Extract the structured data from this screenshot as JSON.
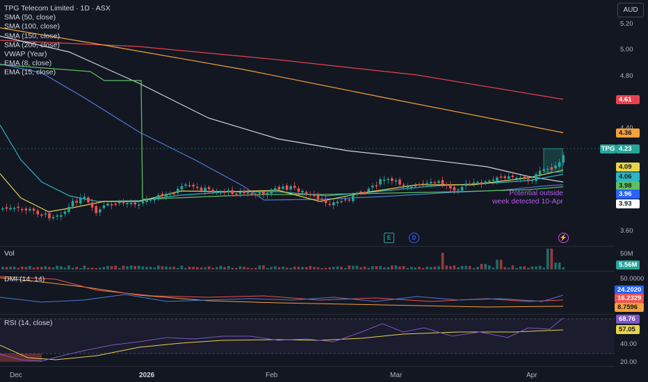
{
  "header": {
    "title": "TPG Telecom Limited · 1D · ASX",
    "currency": "AUD"
  },
  "legend": [
    {
      "label": "SMA (50, close)"
    },
    {
      "label": "SMA (100, close)"
    },
    {
      "label": "SMA (150, close)"
    },
    {
      "label": "SMA (200, close)"
    },
    {
      "label": "VWAP (Year)"
    },
    {
      "label": "EMA (8, close)"
    },
    {
      "label": "EMA (15, close)"
    }
  ],
  "price_axis": [
    "5.20",
    "5.00",
    "4.80",
    "4.40",
    "3.60"
  ],
  "tags": {
    "ticker": "TPG",
    "last": "4.23",
    "sma200": "4.61",
    "sma150": "4.36",
    "ema8": "4.09",
    "ema15": "4.06",
    "sma50": "3.98",
    "vwap": "3.96",
    "other": "3.93"
  },
  "note": "Potential outside week detected 10-Apr",
  "events": {
    "earnings": "E",
    "dividend": "D"
  },
  "volume": {
    "label": "Vol",
    "axis_top": "50M",
    "last": "5.56M"
  },
  "dmi": {
    "label": "DMI (14, 14)",
    "axis_top": "50.0000",
    "plus": "24.2020",
    "minus": "16.2329",
    "adx": "8.7596"
  },
  "rsi": {
    "label": "RSI (14, close)",
    "value": "68.76",
    "ma": "57.05",
    "axis": [
      "40.00",
      "20.00"
    ]
  },
  "x_axis": [
    "Dec",
    "2026",
    "Feb",
    "Mar",
    "Apr"
  ],
  "colors": {
    "up": "#26a69a",
    "down": "#ef5350",
    "sma50": "#4a7bd8",
    "sma100": "#ffffff",
    "sma150": "#f5a13c",
    "sma200": "#e6424f",
    "vwap": "#5fbf62",
    "ema8": "#e8d44a",
    "ema15": "#2bb6c4",
    "rsi": "#7e57c2"
  }
}
